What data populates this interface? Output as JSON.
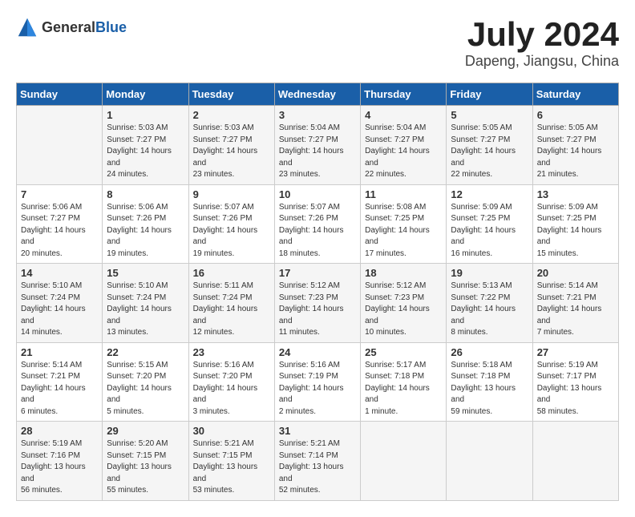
{
  "header": {
    "logo_general": "General",
    "logo_blue": "Blue",
    "month_year": "July 2024",
    "location": "Dapeng, Jiangsu, China"
  },
  "days_of_week": [
    "Sunday",
    "Monday",
    "Tuesday",
    "Wednesday",
    "Thursday",
    "Friday",
    "Saturday"
  ],
  "weeks": [
    [
      {
        "day": "",
        "sunrise": "",
        "sunset": "",
        "daylight": ""
      },
      {
        "day": "1",
        "sunrise": "Sunrise: 5:03 AM",
        "sunset": "Sunset: 7:27 PM",
        "daylight": "Daylight: 14 hours and 24 minutes."
      },
      {
        "day": "2",
        "sunrise": "Sunrise: 5:03 AM",
        "sunset": "Sunset: 7:27 PM",
        "daylight": "Daylight: 14 hours and 23 minutes."
      },
      {
        "day": "3",
        "sunrise": "Sunrise: 5:04 AM",
        "sunset": "Sunset: 7:27 PM",
        "daylight": "Daylight: 14 hours and 23 minutes."
      },
      {
        "day": "4",
        "sunrise": "Sunrise: 5:04 AM",
        "sunset": "Sunset: 7:27 PM",
        "daylight": "Daylight: 14 hours and 22 minutes."
      },
      {
        "day": "5",
        "sunrise": "Sunrise: 5:05 AM",
        "sunset": "Sunset: 7:27 PM",
        "daylight": "Daylight: 14 hours and 22 minutes."
      },
      {
        "day": "6",
        "sunrise": "Sunrise: 5:05 AM",
        "sunset": "Sunset: 7:27 PM",
        "daylight": "Daylight: 14 hours and 21 minutes."
      }
    ],
    [
      {
        "day": "7",
        "sunrise": "Sunrise: 5:06 AM",
        "sunset": "Sunset: 7:27 PM",
        "daylight": "Daylight: 14 hours and 20 minutes."
      },
      {
        "day": "8",
        "sunrise": "Sunrise: 5:06 AM",
        "sunset": "Sunset: 7:26 PM",
        "daylight": "Daylight: 14 hours and 19 minutes."
      },
      {
        "day": "9",
        "sunrise": "Sunrise: 5:07 AM",
        "sunset": "Sunset: 7:26 PM",
        "daylight": "Daylight: 14 hours and 19 minutes."
      },
      {
        "day": "10",
        "sunrise": "Sunrise: 5:07 AM",
        "sunset": "Sunset: 7:26 PM",
        "daylight": "Daylight: 14 hours and 18 minutes."
      },
      {
        "day": "11",
        "sunrise": "Sunrise: 5:08 AM",
        "sunset": "Sunset: 7:25 PM",
        "daylight": "Daylight: 14 hours and 17 minutes."
      },
      {
        "day": "12",
        "sunrise": "Sunrise: 5:09 AM",
        "sunset": "Sunset: 7:25 PM",
        "daylight": "Daylight: 14 hours and 16 minutes."
      },
      {
        "day": "13",
        "sunrise": "Sunrise: 5:09 AM",
        "sunset": "Sunset: 7:25 PM",
        "daylight": "Daylight: 14 hours and 15 minutes."
      }
    ],
    [
      {
        "day": "14",
        "sunrise": "Sunrise: 5:10 AM",
        "sunset": "Sunset: 7:24 PM",
        "daylight": "Daylight: 14 hours and 14 minutes."
      },
      {
        "day": "15",
        "sunrise": "Sunrise: 5:10 AM",
        "sunset": "Sunset: 7:24 PM",
        "daylight": "Daylight: 14 hours and 13 minutes."
      },
      {
        "day": "16",
        "sunrise": "Sunrise: 5:11 AM",
        "sunset": "Sunset: 7:24 PM",
        "daylight": "Daylight: 14 hours and 12 minutes."
      },
      {
        "day": "17",
        "sunrise": "Sunrise: 5:12 AM",
        "sunset": "Sunset: 7:23 PM",
        "daylight": "Daylight: 14 hours and 11 minutes."
      },
      {
        "day": "18",
        "sunrise": "Sunrise: 5:12 AM",
        "sunset": "Sunset: 7:23 PM",
        "daylight": "Daylight: 14 hours and 10 minutes."
      },
      {
        "day": "19",
        "sunrise": "Sunrise: 5:13 AM",
        "sunset": "Sunset: 7:22 PM",
        "daylight": "Daylight: 14 hours and 8 minutes."
      },
      {
        "day": "20",
        "sunrise": "Sunrise: 5:14 AM",
        "sunset": "Sunset: 7:21 PM",
        "daylight": "Daylight: 14 hours and 7 minutes."
      }
    ],
    [
      {
        "day": "21",
        "sunrise": "Sunrise: 5:14 AM",
        "sunset": "Sunset: 7:21 PM",
        "daylight": "Daylight: 14 hours and 6 minutes."
      },
      {
        "day": "22",
        "sunrise": "Sunrise: 5:15 AM",
        "sunset": "Sunset: 7:20 PM",
        "daylight": "Daylight: 14 hours and 5 minutes."
      },
      {
        "day": "23",
        "sunrise": "Sunrise: 5:16 AM",
        "sunset": "Sunset: 7:20 PM",
        "daylight": "Daylight: 14 hours and 3 minutes."
      },
      {
        "day": "24",
        "sunrise": "Sunrise: 5:16 AM",
        "sunset": "Sunset: 7:19 PM",
        "daylight": "Daylight: 14 hours and 2 minutes."
      },
      {
        "day": "25",
        "sunrise": "Sunrise: 5:17 AM",
        "sunset": "Sunset: 7:18 PM",
        "daylight": "Daylight: 14 hours and 1 minute."
      },
      {
        "day": "26",
        "sunrise": "Sunrise: 5:18 AM",
        "sunset": "Sunset: 7:18 PM",
        "daylight": "Daylight: 13 hours and 59 minutes."
      },
      {
        "day": "27",
        "sunrise": "Sunrise: 5:19 AM",
        "sunset": "Sunset: 7:17 PM",
        "daylight": "Daylight: 13 hours and 58 minutes."
      }
    ],
    [
      {
        "day": "28",
        "sunrise": "Sunrise: 5:19 AM",
        "sunset": "Sunset: 7:16 PM",
        "daylight": "Daylight: 13 hours and 56 minutes."
      },
      {
        "day": "29",
        "sunrise": "Sunrise: 5:20 AM",
        "sunset": "Sunset: 7:15 PM",
        "daylight": "Daylight: 13 hours and 55 minutes."
      },
      {
        "day": "30",
        "sunrise": "Sunrise: 5:21 AM",
        "sunset": "Sunset: 7:15 PM",
        "daylight": "Daylight: 13 hours and 53 minutes."
      },
      {
        "day": "31",
        "sunrise": "Sunrise: 5:21 AM",
        "sunset": "Sunset: 7:14 PM",
        "daylight": "Daylight: 13 hours and 52 minutes."
      },
      {
        "day": "",
        "sunrise": "",
        "sunset": "",
        "daylight": ""
      },
      {
        "day": "",
        "sunrise": "",
        "sunset": "",
        "daylight": ""
      },
      {
        "day": "",
        "sunrise": "",
        "sunset": "",
        "daylight": ""
      }
    ]
  ]
}
